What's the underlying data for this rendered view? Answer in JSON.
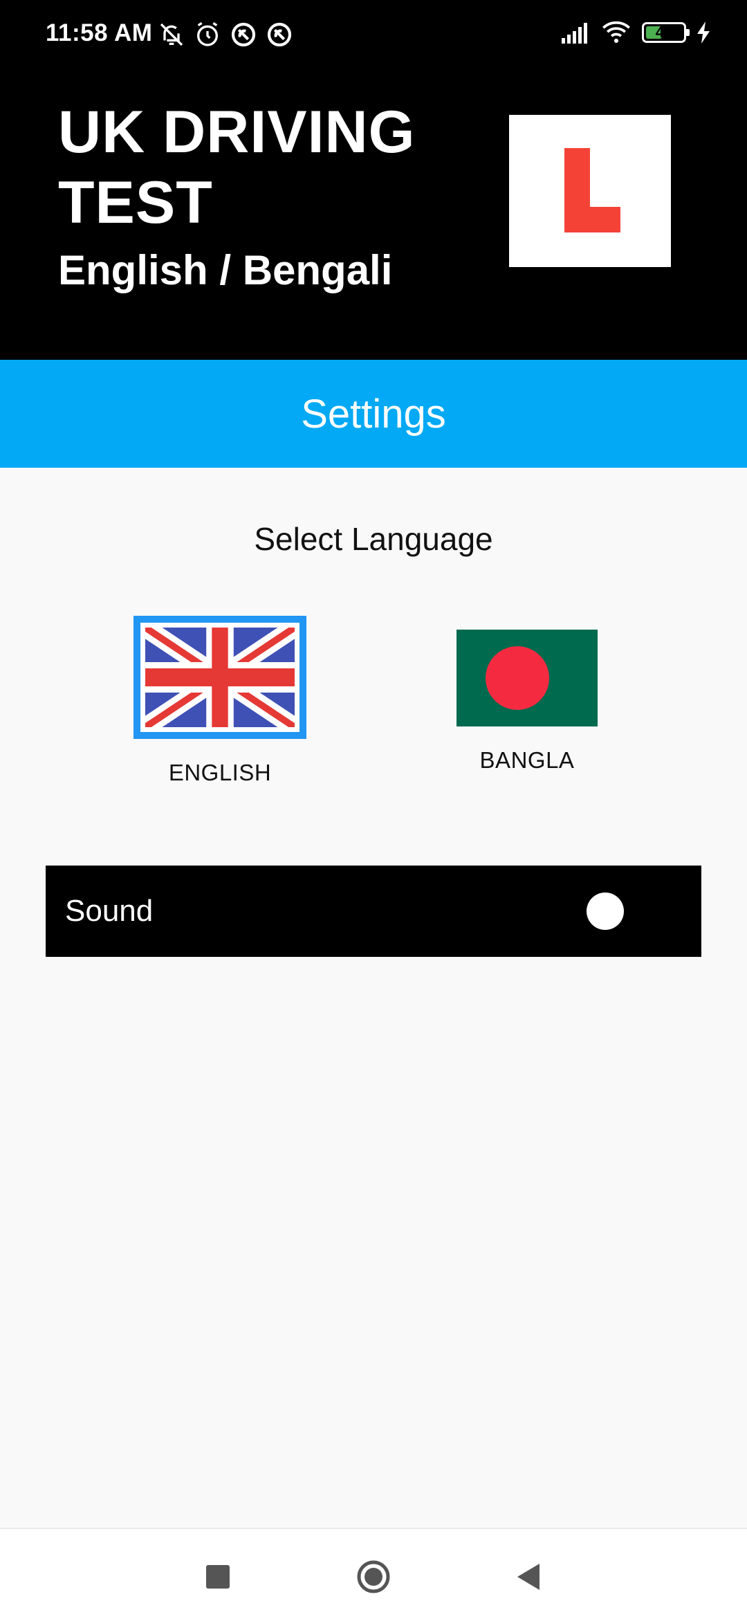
{
  "status_bar": {
    "time": "11:58 AM",
    "battery_level": "45",
    "battery_fraction": 0.45,
    "left_icons": [
      "notifications-muted-icon",
      "alarm-icon",
      "sync-disabled-icon",
      "sync-disabled-icon"
    ],
    "right_icons": [
      "cellular-signal-icon",
      "wifi-icon",
      "battery-icon",
      "charging-icon"
    ]
  },
  "header": {
    "title": "UK DRIVING TEST",
    "subtitle": "English / Bengali",
    "logo_letter": "L",
    "logo_color": "#f44336"
  },
  "settings": {
    "title": "Settings",
    "bar_color": "#03a9f4",
    "select_language_label": "Select Language",
    "languages": [
      {
        "label": "ENGLISH",
        "selected": true,
        "flag": "uk-flag-icon"
      },
      {
        "label": "BANGLA",
        "selected": false,
        "flag": "bangladesh-flag-icon"
      }
    ],
    "selected_border_color": "#2196f3",
    "sound": {
      "label": "Sound",
      "enabled": false
    }
  },
  "nav_bar": {
    "buttons": [
      "recents-icon",
      "home-icon",
      "back-icon"
    ]
  }
}
